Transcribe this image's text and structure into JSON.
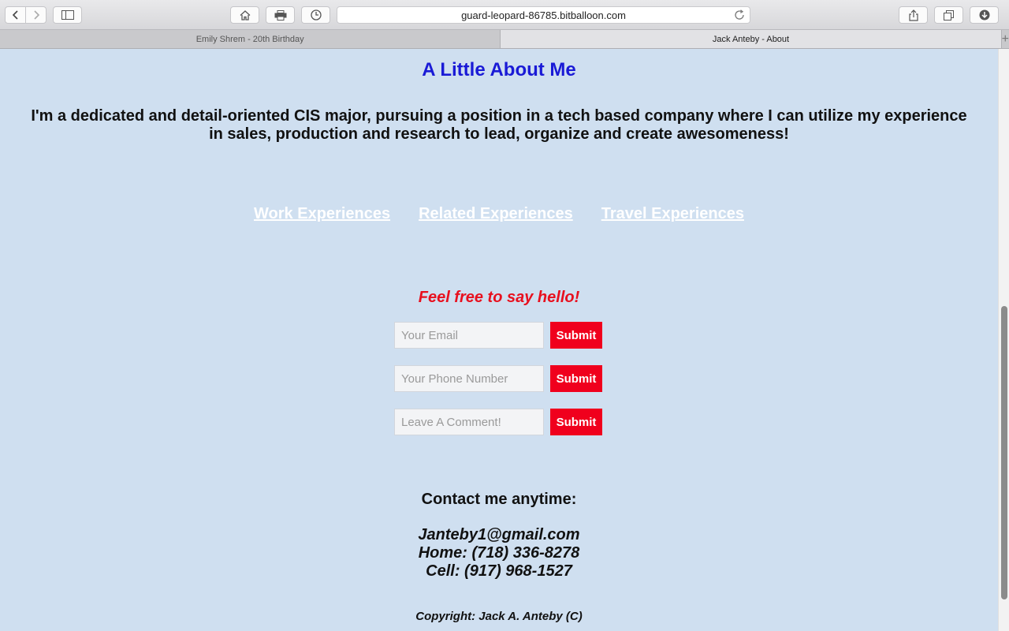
{
  "browser": {
    "url": "guard-leopard-86785.bitballoon.com",
    "tabs": [
      {
        "title": "Emily Shrem - 20th Birthday",
        "active": false
      },
      {
        "title": "Jack Anteby - About",
        "active": true
      }
    ],
    "icons": [
      "back-icon",
      "forward-icon",
      "sidebar-icon",
      "home-icon",
      "print-icon",
      "history-icon",
      "reload-icon",
      "share-icon",
      "tabs-overview-icon",
      "downloads-icon",
      "new-tab-icon"
    ]
  },
  "page": {
    "title": "A Little About Me",
    "intro": "I'm a dedicated and detail-oriented CIS major, pursuing a position in a tech based company where I can utilize my experience in sales, production and research to lead, organize and create awesomeness!",
    "links": [
      "Work Experiences",
      "Related Experiences",
      "Travel Experiences"
    ],
    "hello": "Feel free to say hello!",
    "form": [
      {
        "placeholder": "Your Email",
        "value": "",
        "button": "Submit"
      },
      {
        "placeholder": "Your Phone Number",
        "value": "",
        "button": "Submit"
      },
      {
        "placeholder": "Leave A Comment!",
        "value": "",
        "button": "Submit"
      }
    ],
    "contact_heading": "Contact me anytime:",
    "contact": {
      "email": "Janteby1@gmail.com",
      "home": "Home: (718) 336-8278",
      "cell": "Cell: (917) 968-1527"
    },
    "copyright": "Copyright: Jack A. Anteby (C)"
  },
  "colors": {
    "background": "#cfdff0",
    "title": "#1a1ad6",
    "hello": "#e8101e",
    "submit_button": "#f0001d",
    "links": "#ffffff"
  }
}
